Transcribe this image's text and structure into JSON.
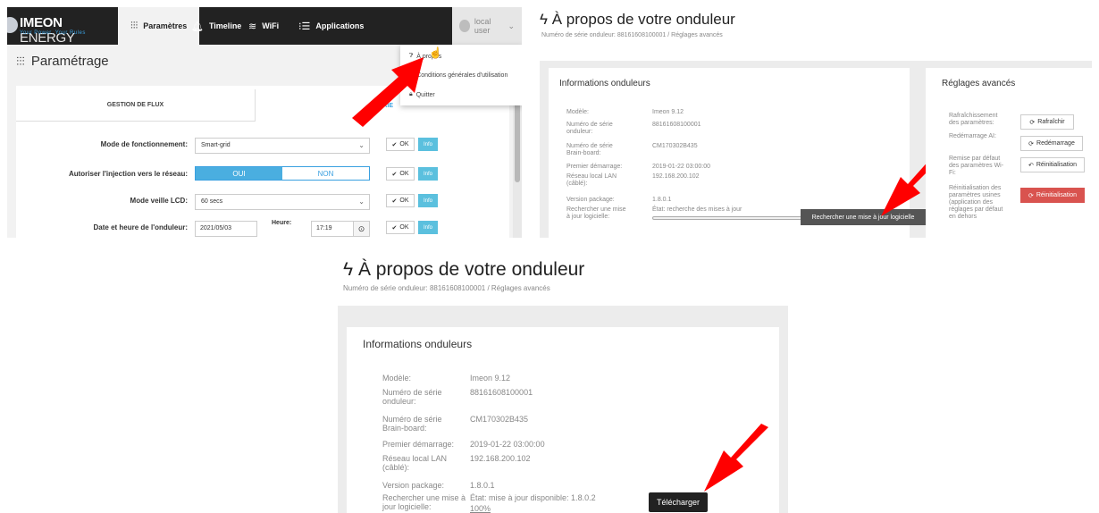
{
  "colors": {
    "accent": "#3aa0e0",
    "info": "#5bc0de",
    "danger": "#d9534f",
    "arrow": "#ff0000",
    "topbar": "#222222"
  },
  "panel1": {
    "logo": {
      "brand_bold": "IMEON",
      "brand_light": " ENERGY",
      "tagline": "Your Power. Your Rules"
    },
    "nav": {
      "parametres": "Paramètres",
      "timeline": "Timeline",
      "wifi": "WiFi",
      "applications": "Applications"
    },
    "user": "local user",
    "page_title": "Paramétrage",
    "tabs": {
      "flux": "GESTION DE FLUX",
      "second": "TTERIE"
    },
    "menu": {
      "apropos": "À propos",
      "cgu": "Conditions générales d'utilisation",
      "quitter": "Quitter"
    },
    "rows": {
      "mode_label": "Mode de fonctionnement:",
      "mode_value": "Smart-grid",
      "injection_label": "Autoriser l'injection vers le réseau:",
      "oui": "OUI",
      "non": "NON",
      "veille_label": "Mode veille LCD:",
      "veille_value": "60 secs",
      "date_label": "Date et heure de l'onduleur:",
      "date_value": "2021/05/03",
      "heure_label": "Heure:",
      "heure_value": "17:19",
      "ok": "OK",
      "info": "Info"
    }
  },
  "about": {
    "title": "À propos de votre onduleur",
    "subtitle": "Numéro de série onduleur: 88161608100001 / Réglages avancés",
    "card_title": "Informations onduleurs",
    "labels": {
      "modele": "Modèle:",
      "serie": "Numéro de série onduleur:",
      "brain": "Numéro de série Brain-board:",
      "premier": "Premier démarrage:",
      "lan": "Réseau local LAN (câblé):",
      "version": "Version package:",
      "recherche": "Rechercher une mise à jour logicielle:"
    },
    "values": {
      "modele": "Imeon 9.12",
      "serie": "88161608100001",
      "brain": "CM170302B435",
      "premier": "2019-01-22 03:00:00",
      "lan": "192.168.200.102",
      "version": "1.8.0.1"
    }
  },
  "panel2": {
    "etat": "État: recherche des mises à jour",
    "search_button": "Rechercher une mise à jour logicielle",
    "reglages": {
      "title": "Réglages avancés",
      "rafraichissement": "Rafraîchissement des paramètres:",
      "redemarrage": "Redémarrage AI:",
      "remise": "Remise par défaut des paramètres Wi-Fi:",
      "reinit_usine": "Réinitialisation des paramètres usines (application des réglages par défaut en dehors",
      "btn_rafraichir": "Rafraîchir",
      "btn_redemarrage": "Redémarrage",
      "btn_reinit": "Réinitialisation",
      "btn_reinit_danger": "Réinitialisation"
    }
  },
  "panel3": {
    "etat": "État: mise à jour disponible: 1.8.0.2",
    "progress_text": "100%",
    "progress": 1.0,
    "download_button": "Télécharger"
  }
}
